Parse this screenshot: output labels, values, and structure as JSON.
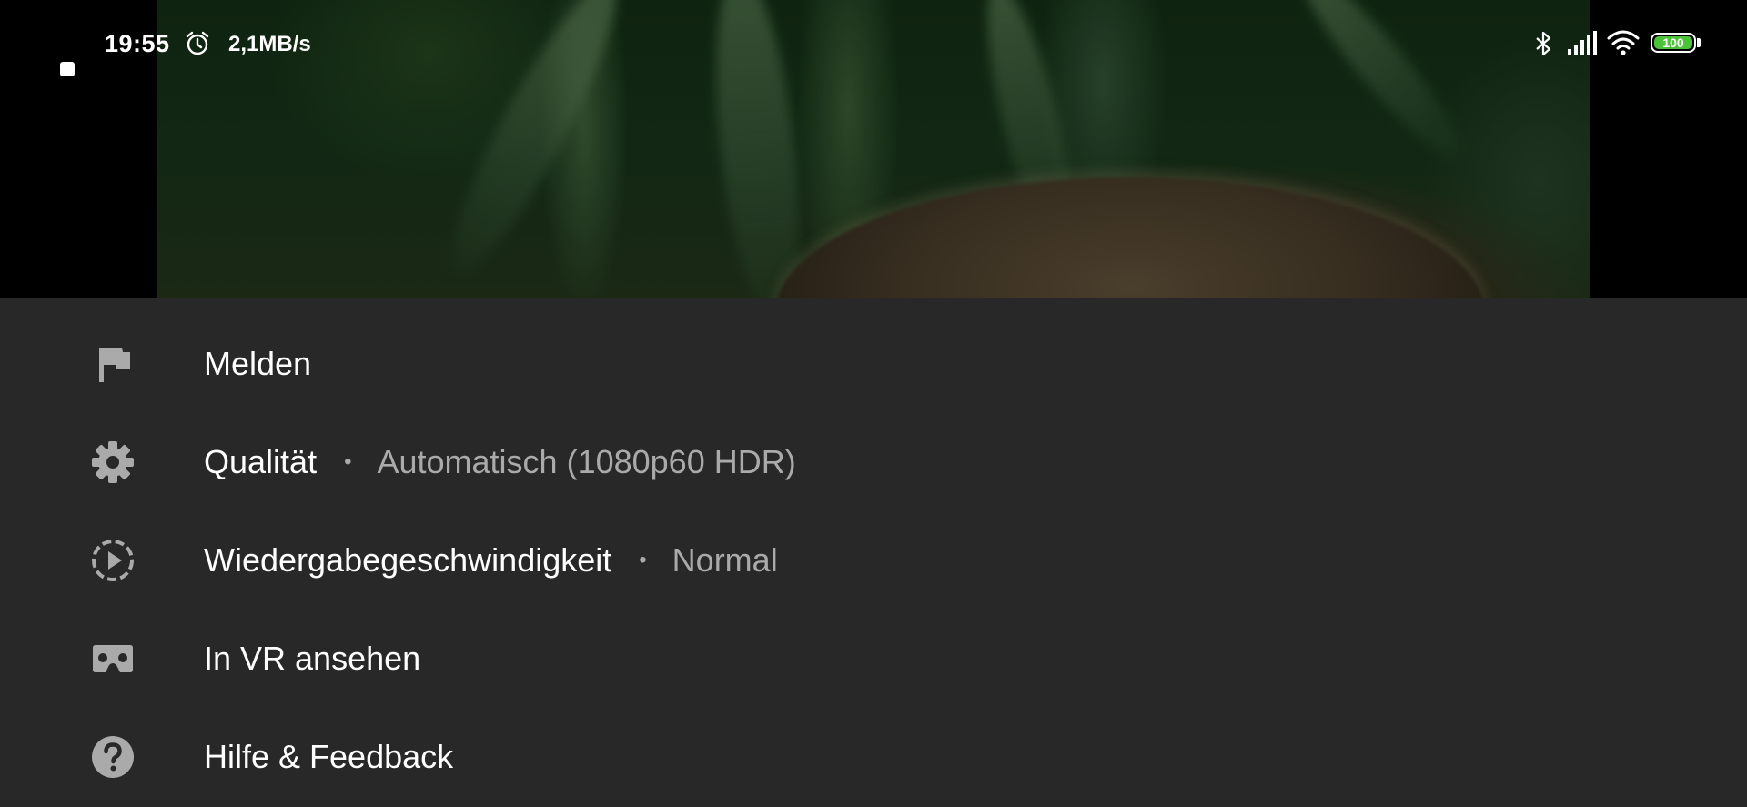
{
  "status_bar": {
    "time": "19:55",
    "net_speed": "2,1MB/s",
    "battery_level": "100",
    "icons": [
      "alarm-icon",
      "bluetooth-icon",
      "signal-icon",
      "wifi-icon",
      "battery-icon"
    ]
  },
  "colors": {
    "sheet_background": "#282828",
    "label": "#ffffff",
    "secondary": "#aaaaaa",
    "icon": "#aaaaaa",
    "battery_fill": "#4cc23a"
  },
  "menu": {
    "items": [
      {
        "icon": "flag-icon",
        "label": "Melden"
      },
      {
        "icon": "gear-icon",
        "label": "Qualität",
        "separator": "•",
        "value": "Automatisch (1080p60 HDR)"
      },
      {
        "icon": "playback-speed-icon",
        "label": "Wiedergabegeschwindigkeit",
        "separator": "•",
        "value": "Normal"
      },
      {
        "icon": "vr-headset-icon",
        "label": "In VR ansehen"
      },
      {
        "icon": "help-icon",
        "label": "Hilfe & Feedback"
      }
    ]
  }
}
